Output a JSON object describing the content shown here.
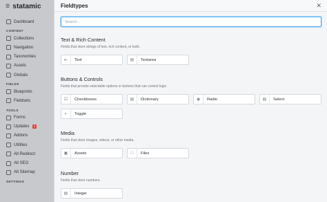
{
  "brand": {
    "menu_icon": "hamburger-icon",
    "name": "statamic"
  },
  "sidebar": {
    "sections": [
      {
        "label": "CONTENT"
      },
      {
        "label": "FIELDS"
      },
      {
        "label": "TOOLS"
      },
      {
        "label": "SETTINGS"
      }
    ],
    "items": [
      {
        "label": "Dashboard",
        "icon": "dashboard-icon"
      },
      {
        "label": "Collections",
        "icon": "collections-icon"
      },
      {
        "label": "Navigation",
        "icon": "navigation-icon"
      },
      {
        "label": "Taxonomies",
        "icon": "taxonomies-icon"
      },
      {
        "label": "Assets",
        "icon": "assets-icon"
      },
      {
        "label": "Globals",
        "icon": "globals-icon"
      },
      {
        "label": "Blueprints",
        "icon": "blueprints-icon"
      },
      {
        "label": "Fieldsets",
        "icon": "fieldsets-icon"
      },
      {
        "label": "Forms",
        "icon": "forms-icon"
      },
      {
        "label": "Updates",
        "icon": "updates-icon",
        "badge": "1"
      },
      {
        "label": "Addons",
        "icon": "addons-icon"
      },
      {
        "label": "Utilities",
        "icon": "utilities-icon"
      },
      {
        "label": "Alt Redirect",
        "icon": "redirect-icon"
      },
      {
        "label": "Alt SEO",
        "icon": "seo-icon"
      },
      {
        "label": "Alt Sitemap",
        "icon": "sitemap-icon"
      }
    ]
  },
  "panel": {
    "title": "Fieldtypes",
    "close_icon": "close-icon",
    "search": {
      "placeholder": "Search...",
      "value": ""
    },
    "groups": [
      {
        "title": "Text & Rich Content",
        "description": "Fields that store strings of text, rich content, or both.",
        "fieldtypes": [
          {
            "label": "Text",
            "icon": "text-icon"
          },
          {
            "label": "Textarea",
            "icon": "textarea-icon"
          }
        ]
      },
      {
        "title": "Buttons & Controls",
        "description": "Fields that provide selectable options or buttons that can control logic.",
        "fieldtypes": [
          {
            "label": "Checkboxes",
            "icon": "checkbox-icon"
          },
          {
            "label": "Dictionary",
            "icon": "dictionary-icon"
          },
          {
            "label": "Radio",
            "icon": "radio-icon"
          },
          {
            "label": "Select",
            "icon": "select-icon"
          },
          {
            "label": "Toggle",
            "icon": "toggle-icon"
          }
        ]
      },
      {
        "title": "Media",
        "description": "Fields that store images, videos, or other media.",
        "fieldtypes": [
          {
            "label": "Assets",
            "icon": "image-icon"
          },
          {
            "label": "Files",
            "icon": "file-icon"
          }
        ]
      },
      {
        "title": "Number",
        "description": "Fields that store numbers.",
        "fieldtypes": [
          {
            "label": "Integer",
            "icon": "integer-icon"
          }
        ]
      }
    ]
  }
}
